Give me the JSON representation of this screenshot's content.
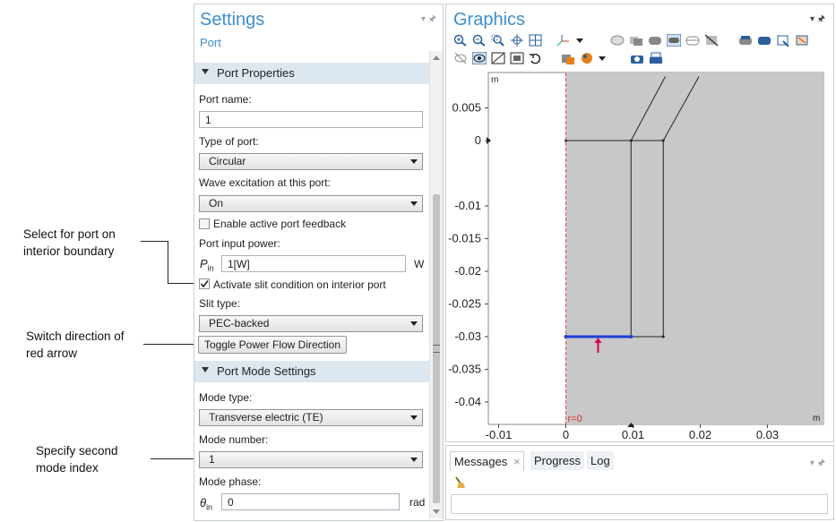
{
  "callouts": {
    "interior": [
      "Select for port on",
      "interior boundary"
    ],
    "direction": [
      "Switch direction of",
      "red arrow"
    ],
    "mode": [
      "Specify second",
      "mode index"
    ]
  },
  "settings": {
    "title": "Settings",
    "subtitle": "Port",
    "pin_icons": "▾ 🖈",
    "section1": "Port Properties",
    "port_name_label": "Port name:",
    "port_name_value": "1",
    "type_label": "Type of port:",
    "type_value": "Circular",
    "wave_label": "Wave excitation at this port:",
    "wave_value": "On",
    "enable_feedback": "Enable active port feedback",
    "input_power_label": "Port input power:",
    "pin_symbol": "P",
    "pin_sub": "in",
    "pin_value": "1[W]",
    "pin_unit": "W",
    "slit_activate": "Activate slit condition on interior port",
    "slit_type_label": "Slit type:",
    "slit_type_value": "PEC-backed",
    "toggle_button": "Toggle Power Flow Direction",
    "section2": "Port Mode Settings",
    "mode_type_label": "Mode type:",
    "mode_type_value": "Transverse electric (TE)",
    "mode_number_label": "Mode number:",
    "mode_number_value": "1",
    "mode_phase_label": "Mode phase:",
    "theta_symbol": "θ",
    "theta_sub": "in",
    "phase_value": "0",
    "phase_unit": "rad"
  },
  "graphics": {
    "title": "Graphics",
    "y_unit": "m",
    "x_unit": "m",
    "r0_label": "r=0",
    "y_ticks": [
      "0.005",
      "0",
      "-0.01",
      "-0.015",
      "-0.02",
      "-0.025",
      "-0.03",
      "-0.035",
      "-0.04"
    ],
    "x_ticks": [
      "-0.01",
      "0",
      "0.01",
      "0.02",
      "0.03"
    ],
    "y_tick_values": [
      0.005,
      0,
      -0.01,
      -0.015,
      -0.02,
      -0.025,
      -0.03,
      -0.035,
      -0.04
    ],
    "x_tick_values": [
      -0.01,
      0,
      0.01,
      0.02,
      0.03
    ],
    "port_color": "#1f3fd6",
    "arrow_color": "#e0004d",
    "domain_color": "#c8c8c8"
  },
  "messages": {
    "tabs": [
      "Messages",
      "Progress",
      "Log"
    ],
    "close": "×"
  }
}
